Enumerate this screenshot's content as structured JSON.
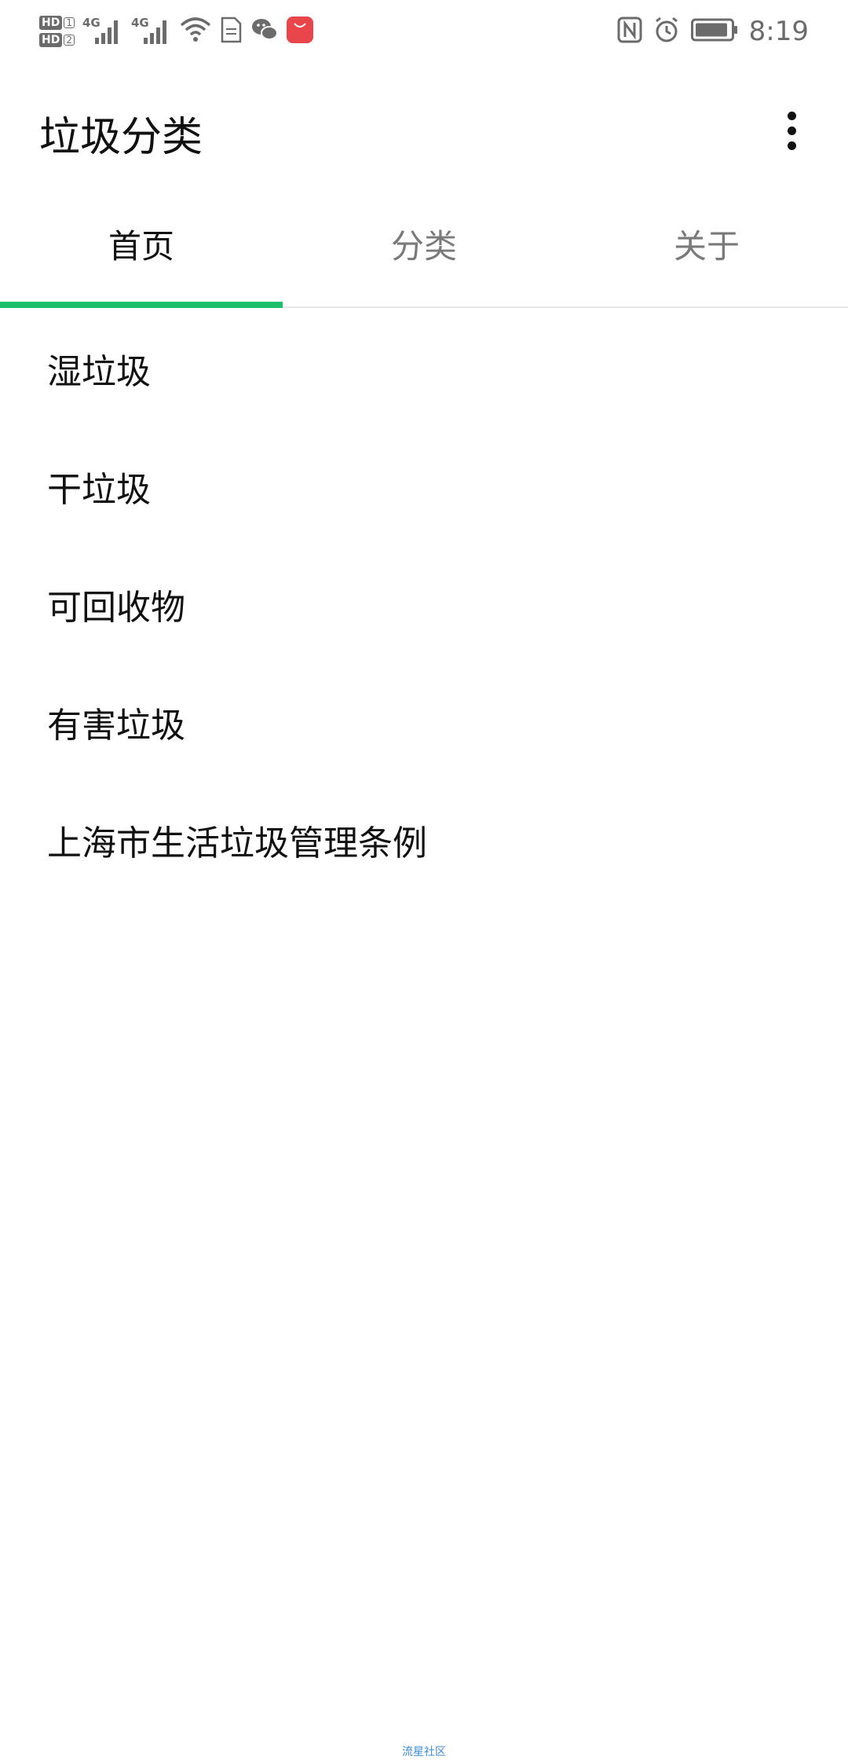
{
  "status_bar": {
    "hd1": "HD",
    "hd1_sim": "1",
    "hd2": "HD",
    "hd2_sim": "2",
    "net1": "4G",
    "net2": "4G",
    "time": "8:19",
    "icons": [
      "signal-icon",
      "wifi-icon",
      "doc-icon",
      "wechat-icon",
      "huawei-appgallery-icon",
      "nfc-icon",
      "alarm-icon",
      "battery-icon"
    ]
  },
  "app_bar": {
    "title": "垃圾分类",
    "more_icon": "more-vert-icon"
  },
  "tabs": [
    {
      "label": "首页",
      "active": true
    },
    {
      "label": "分类",
      "active": false
    },
    {
      "label": "关于",
      "active": false
    }
  ],
  "accent_color": "#1dc06a",
  "list": [
    {
      "label": "湿垃圾"
    },
    {
      "label": "干垃圾"
    },
    {
      "label": "可回收物"
    },
    {
      "label": "有害垃圾"
    },
    {
      "label": "上海市生活垃圾管理条例"
    }
  ],
  "watermark": "流星社区"
}
